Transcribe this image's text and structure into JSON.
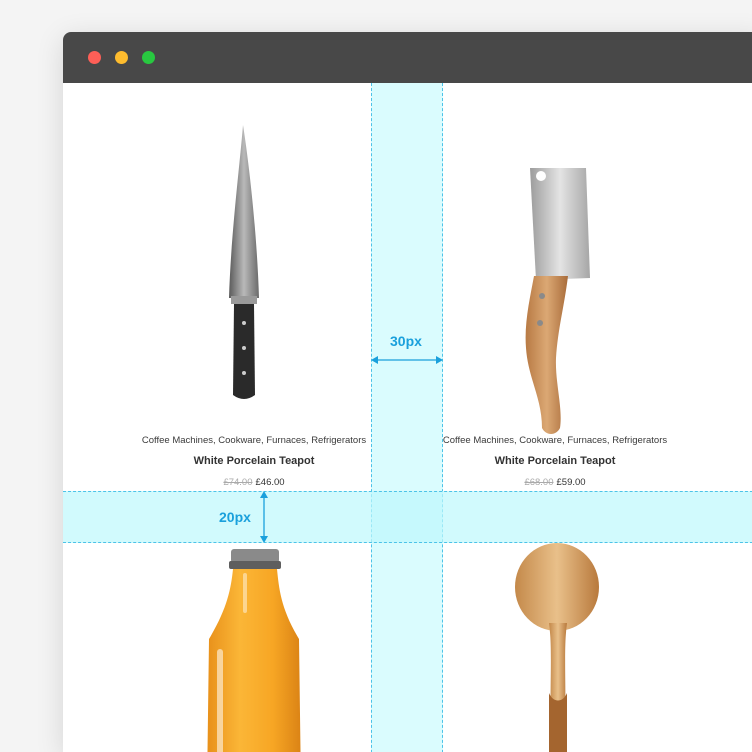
{
  "window": {
    "controls": [
      "close",
      "minimize",
      "maximize"
    ],
    "colors": {
      "close": "#fe5f57",
      "minimize": "#febc2e",
      "maximize": "#28c840",
      "titlebar": "#484848"
    }
  },
  "spacing": {
    "column_gap_label": "30px",
    "row_gap_label": "20px",
    "accent_color": "#1aa0dc"
  },
  "products": [
    {
      "image": "chef-knife",
      "categories": "Coffee Machines, Cookware, Furnaces, Refrigerators",
      "title": "White Porcelain Teapot",
      "old_price": "£74.00",
      "price": "£46.00"
    },
    {
      "image": "cleaver-knife",
      "categories": "Coffee Machines, Cookware, Furnaces, Refrigerators",
      "title": "White Porcelain Teapot",
      "old_price": "£68.00",
      "price": "£59.00"
    },
    {
      "image": "juice-bottle"
    },
    {
      "image": "wooden-spoon"
    }
  ]
}
